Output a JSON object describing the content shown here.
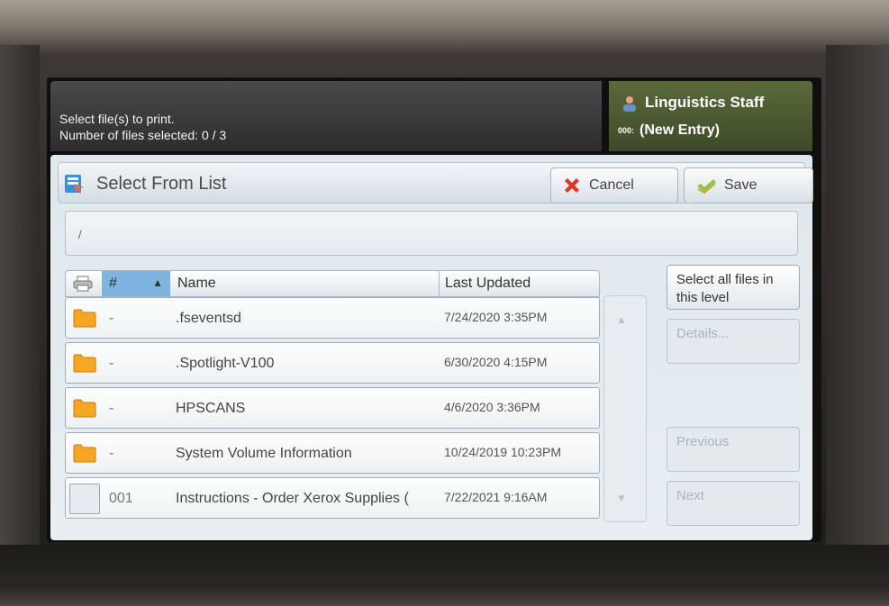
{
  "status": {
    "line1": "Select file(s) to print.",
    "line2": "Number of files selected: 0 / 3"
  },
  "user": {
    "name": "Linguistics Staff",
    "code": "000:",
    "entry": "(New Entry)"
  },
  "panel": {
    "title": "Select From List",
    "cancel_label": "Cancel",
    "save_label": "Save",
    "path": "/"
  },
  "table": {
    "columns": {
      "number": "#",
      "name": "Name",
      "last_updated": "Last Updated"
    },
    "rows": [
      {
        "type": "folder",
        "number": "-",
        "name": ".fseventsd",
        "date": "7/24/2020 3:35PM"
      },
      {
        "type": "folder",
        "number": "-",
        "name": ".Spotlight-V100",
        "date": "6/30/2020 4:15PM"
      },
      {
        "type": "folder",
        "number": "-",
        "name": "HPSCANS",
        "date": "4/6/2020 3:36PM"
      },
      {
        "type": "folder",
        "number": "-",
        "name": "System Volume Information",
        "date": "10/24/2019 10:23PM"
      },
      {
        "type": "file",
        "number": "001",
        "name": "Instructions - Order Xerox Supplies (",
        "date": "7/22/2021 9:16AM"
      }
    ]
  },
  "side": {
    "select_all": "Select all files in this level",
    "details": "Details...",
    "previous": "Previous",
    "next": "Next"
  },
  "colors": {
    "accent_sort": "#7fb4e0",
    "user_panel": "#4e5c32",
    "folder": "#f5a623"
  }
}
